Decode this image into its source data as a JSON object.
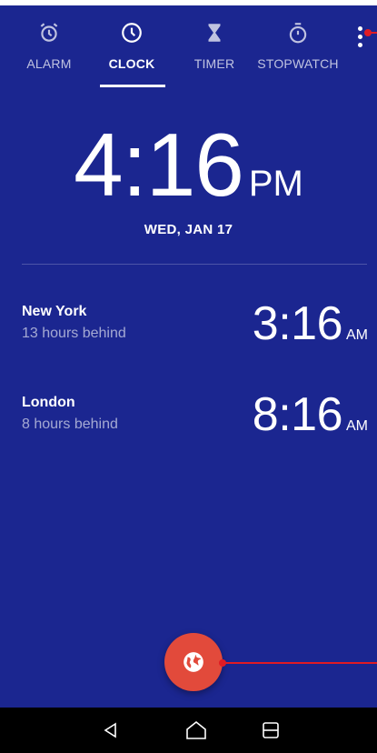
{
  "tabs": [
    {
      "label": "ALARM",
      "icon": "alarm-clock-icon",
      "active": false
    },
    {
      "label": "CLOCK",
      "icon": "clock-icon",
      "active": true
    },
    {
      "label": "TIMER",
      "icon": "hourglass-icon",
      "active": false
    },
    {
      "label": "STOPWATCH",
      "icon": "stopwatch-icon",
      "active": false
    }
  ],
  "overflow_menu": {
    "icon": "more-vert-icon"
  },
  "main_clock": {
    "time": "4:16",
    "ampm": "PM",
    "date": "WED, JAN 17"
  },
  "cities": [
    {
      "name": "New York",
      "offset": "13 hours behind",
      "time": "3:16",
      "ampm": "AM"
    },
    {
      "name": "London",
      "offset": "8 hours behind",
      "time": "8:16",
      "ampm": "AM"
    }
  ],
  "fab": {
    "icon": "globe-icon"
  },
  "navbar": {
    "back_icon": "back-triangle-icon",
    "home_icon": "home-icon",
    "recents_icon": "recents-icon"
  },
  "colors": {
    "background": "#1b2690",
    "fab": "#e24a3b",
    "annotation": "#e01b24",
    "navbar": "#000000"
  }
}
